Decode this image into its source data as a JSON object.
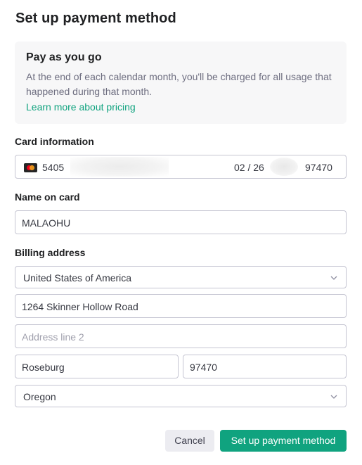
{
  "title": "Set up payment method",
  "info": {
    "title": "Pay as you go",
    "body": "At the end of each calendar month, you'll be charged for all usage that happened during that month.",
    "link": "Learn more about pricing"
  },
  "card": {
    "label": "Card information",
    "number_prefix": "5405",
    "expiry": "02 / 26",
    "zip": "97470",
    "brand_icon": "mastercard-icon"
  },
  "name": {
    "label": "Name on card",
    "value": "MALAOHU"
  },
  "billing": {
    "label": "Billing address",
    "country": "United States of America",
    "line1": "1264  Skinner Hollow Road",
    "line2_placeholder": "Address line 2",
    "city": "Roseburg",
    "zip": "97470",
    "state": "Oregon"
  },
  "buttons": {
    "cancel": "Cancel",
    "submit": "Set up payment method"
  },
  "colors": {
    "accent": "#10a37f",
    "link": "#10a37f"
  }
}
